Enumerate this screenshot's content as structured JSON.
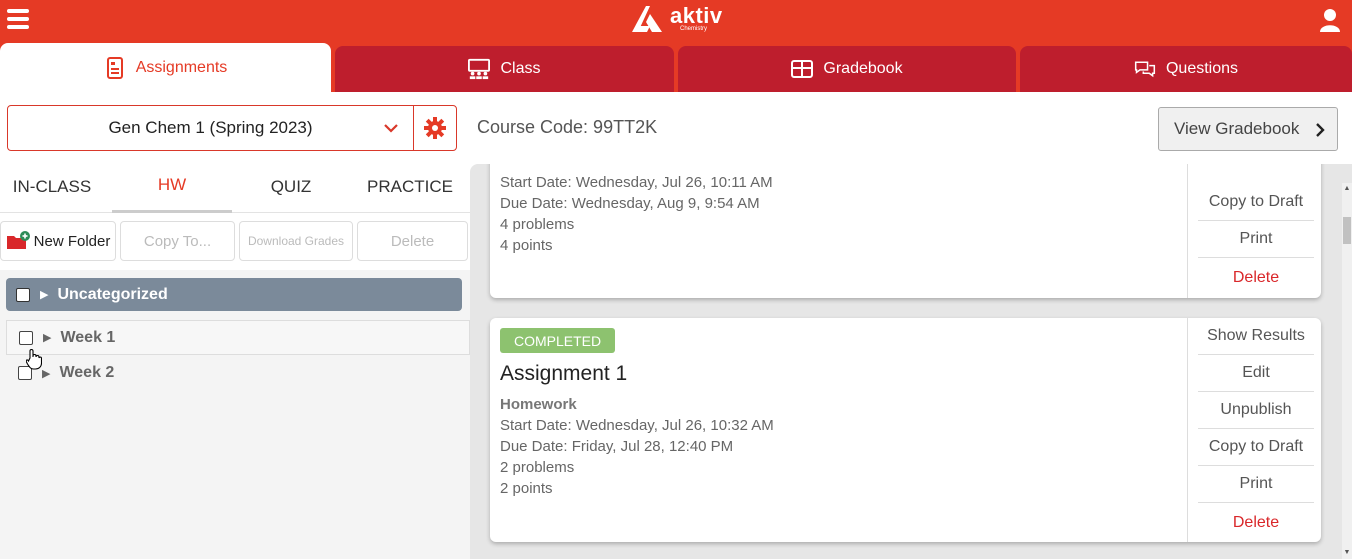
{
  "brand": {
    "name": "aktiv",
    "sub": "Chemistry",
    "color": "#e53a25"
  },
  "tabs": [
    {
      "label": "Assignments",
      "icon": "document-icon"
    },
    {
      "label": "Class",
      "icon": "class-icon"
    },
    {
      "label": "Gradebook",
      "icon": "table-icon"
    },
    {
      "label": "Questions",
      "icon": "chat-icon"
    }
  ],
  "course": {
    "selected": "Gen Chem 1 (Spring 2023)",
    "code": "Course Code: 99TT2K",
    "view_gradebook": "View Gradebook"
  },
  "subtabs": [
    "IN-CLASS",
    "HW",
    "QUIZ",
    "PRACTICE"
  ],
  "toolbar": {
    "new_folder": "New Folder",
    "copy_to": "Copy To...",
    "download_grades": "Download Grades",
    "delete": "Delete"
  },
  "folders": [
    {
      "label": "Uncategorized"
    },
    {
      "label": "Week 1"
    },
    {
      "label": "Week 2"
    }
  ],
  "cards": [
    {
      "lines": [
        "Start Date: Wednesday, Jul 26, 10:11 AM",
        "Due Date: Wednesday, Aug 9, 9:54 AM",
        "4 problems",
        "4 points"
      ],
      "actions": [
        "Copy to Draft",
        "Print",
        "Delete"
      ]
    },
    {
      "badge": "COMPLETED",
      "title": "Assignment 1",
      "type": "Homework",
      "lines": [
        "Start Date: Wednesday, Jul 26, 10:32 AM",
        "Due Date: Friday, Jul 28, 12:40 PM",
        "2 problems",
        "2 points"
      ],
      "actions": [
        "Show Results",
        "Edit",
        "Unpublish",
        "Copy to Draft",
        "Print",
        "Delete"
      ]
    }
  ]
}
